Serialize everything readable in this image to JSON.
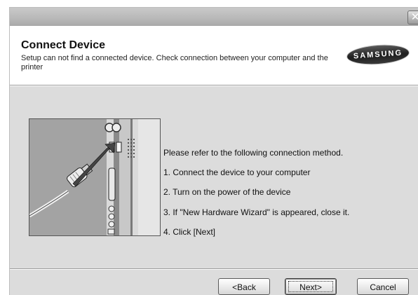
{
  "window": {
    "close_glyph": "✕"
  },
  "header": {
    "title": "Connect Device",
    "subtitle": "Setup can not find a connected device. Check connection between your computer and the printer",
    "logo_text": "SAMSUNG"
  },
  "instructions": {
    "intro": "Please refer to the following connection method.",
    "steps": [
      "1. Connect the device to your computer",
      "2. Turn on the power of the device",
      "3. If \"New Hardware Wizard\" is appeared, close it.",
      "4. Click [Next]"
    ]
  },
  "buttons": {
    "back": "<Back",
    "next": "Next>",
    "cancel": "Cancel"
  },
  "illustration": {
    "icon": "usb-cable-connection-icon"
  }
}
